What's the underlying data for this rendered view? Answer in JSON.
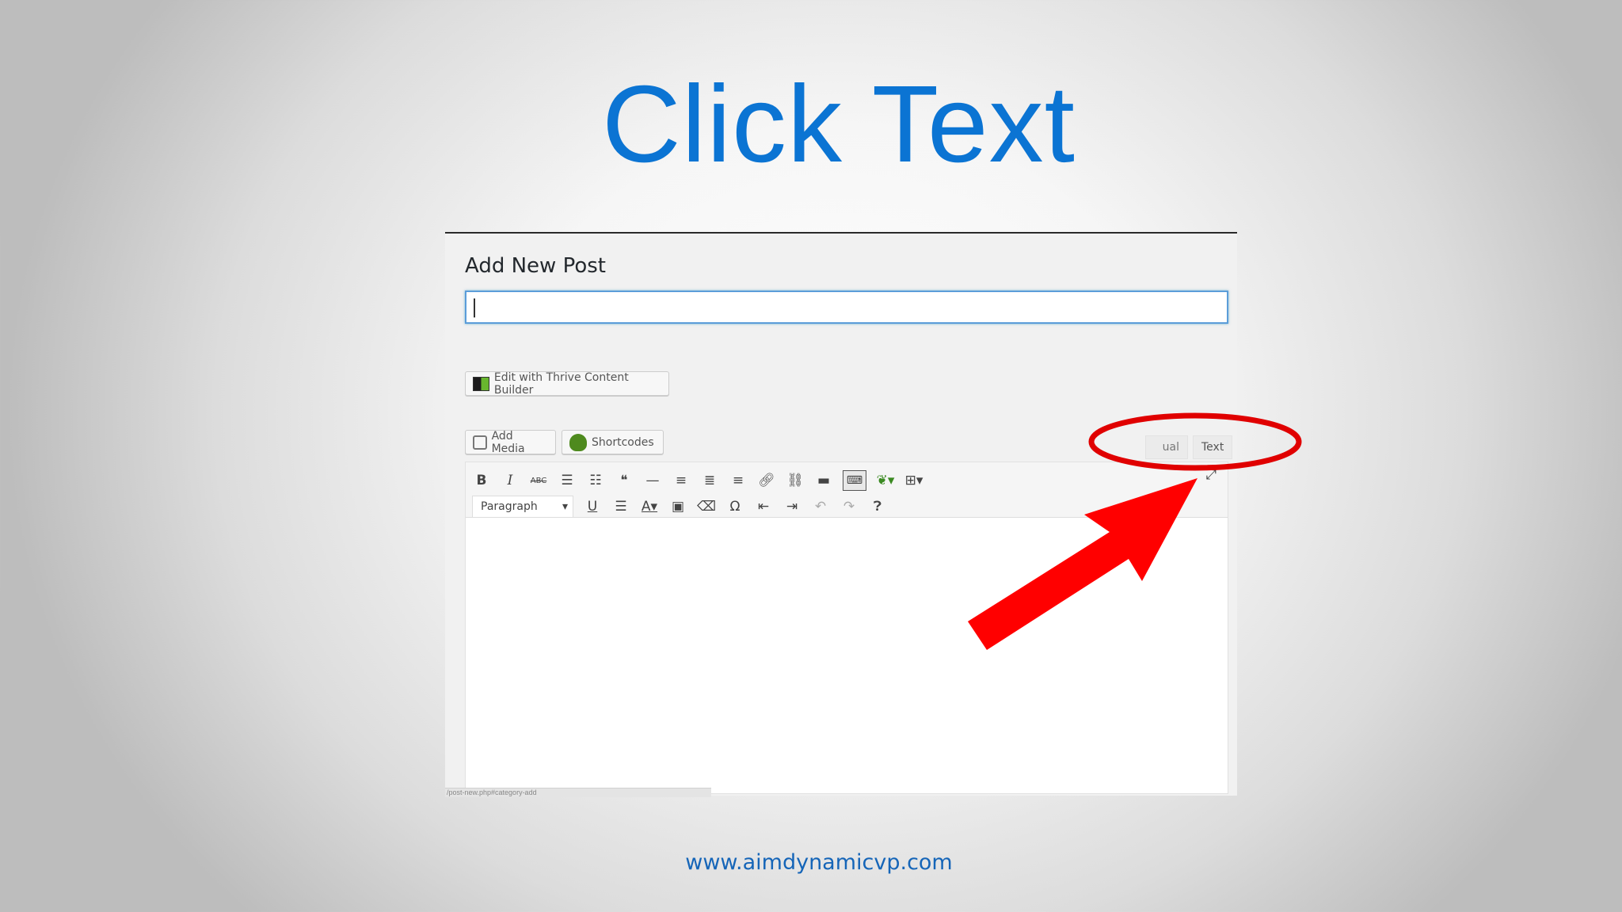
{
  "slide": {
    "title": "Click Text",
    "footer_url": "www.aimdynamicvp.com"
  },
  "editor": {
    "heading": "Add New Post",
    "title_value": "",
    "tcb_button": "Edit with Thrive Content Builder",
    "add_media_button": "Add Media",
    "shortcodes_button": "Shortcodes",
    "tab_visual": "ual",
    "tab_text": "Text",
    "format_select": "Paragraph",
    "status_text": "/post-new.php#category-add"
  },
  "icons": {
    "toolbar_row1": [
      "bold-icon",
      "italic-icon",
      "strikethrough-icon",
      "bullet-list-icon",
      "numbered-list-icon",
      "blockquote-icon",
      "horizontal-line-icon",
      "align-left-icon",
      "align-center-icon",
      "align-right-icon",
      "insert-link-icon",
      "remove-link-icon",
      "read-more-icon",
      "toolbar-toggle-icon",
      "leaf-icon",
      "grid-icon"
    ],
    "toolbar_row2": [
      "underline-icon",
      "justify-icon",
      "text-color-icon",
      "paste-text-icon",
      "clear-format-icon",
      "special-char-icon",
      "outdent-icon",
      "indent-icon",
      "undo-icon",
      "redo-icon",
      "help-icon"
    ]
  },
  "colors": {
    "title": "#0b74d3",
    "annotation": "#e00000",
    "focus_border": "#5b9dd9"
  }
}
